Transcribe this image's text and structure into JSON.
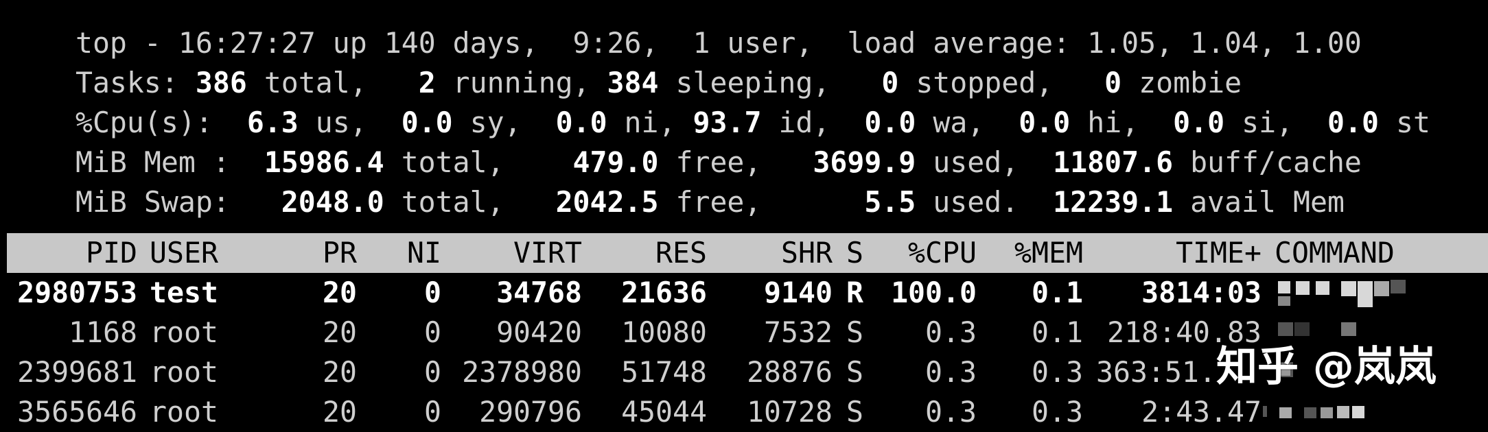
{
  "summary": {
    "line1": {
      "prefix": "top - ",
      "time": "16:27:27",
      "up_label": " up ",
      "uptime": "140 days,  9:26,",
      "users": "  1 user,",
      "load_label": "  load average: ",
      "load": "1.05, 1.04, 1.00"
    },
    "tasks": {
      "label": "Tasks: ",
      "total": "386",
      "total_label": " total,",
      "running": "   2",
      "running_label": " running, ",
      "sleeping": "384",
      "sleeping_label": " sleeping,",
      "stopped": "   0",
      "stopped_label": " stopped,",
      "zombie": "   0",
      "zombie_label": " zombie"
    },
    "cpu": {
      "label": "%Cpu(s): ",
      "us": " 6.3",
      "us_label": " us, ",
      "sy": " 0.0",
      "sy_label": " sy, ",
      "ni": " 0.0",
      "ni_label": " ni, ",
      "id": "93.7",
      "id_label": " id, ",
      "wa": " 0.0",
      "wa_label": " wa, ",
      "hi": " 0.0",
      "hi_label": " hi, ",
      "si": " 0.0",
      "si_label": " si, ",
      "st": " 0.0",
      "st_label": " st"
    },
    "mem": {
      "label": "MiB Mem : ",
      "total": " 15986.4",
      "total_label": " total,",
      "free": "    479.0",
      "free_label": " free,",
      "used": "   3699.9",
      "used_label": " used,",
      "buff": "  11807.6",
      "buff_label": " buff/cache"
    },
    "swap": {
      "label": "MiB Swap: ",
      "total": "  2048.0",
      "total_label": " total,",
      "free": "   2042.5",
      "free_label": " free,",
      "used": "      5.5",
      "used_label": " used.",
      "avail": "  12239.1",
      "avail_label": " avail Mem"
    }
  },
  "columns": [
    "PID",
    "USER",
    "PR",
    "NI",
    "VIRT",
    "RES",
    "SHR",
    "S",
    "%CPU",
    "%MEM",
    "TIME+",
    "COMMAND"
  ],
  "processes": [
    {
      "pid": "2980753",
      "user": "test",
      "pr": "20",
      "ni": "0",
      "virt": "34768",
      "res": "21636",
      "shr": "9140",
      "s": "R",
      "cpu": "100.0",
      "mem": "0.1",
      "time": "3814:03"
    },
    {
      "pid": "1168",
      "user": "root",
      "pr": "20",
      "ni": "0",
      "virt": "90420",
      "res": "10080",
      "shr": "7532",
      "s": "S",
      "cpu": "0.3",
      "mem": "0.1",
      "time": "218:40.83"
    },
    {
      "pid": "2399681",
      "user": "root",
      "pr": "20",
      "ni": "0",
      "virt": "2378980",
      "res": "51748",
      "shr": "28876",
      "s": "S",
      "cpu": "0.3",
      "mem": "0.3",
      "time": "363:51."
    },
    {
      "pid": "3565646",
      "user": "root",
      "pr": "20",
      "ni": "0",
      "virt": "290796",
      "res": "45044",
      "shr": "10728",
      "s": "S",
      "cpu": "0.3",
      "mem": "0.3",
      "time": "2:43.47"
    }
  ],
  "watermark": "知乎 @岚岚",
  "colors": {
    "background": "#000000",
    "text": "#cfcfcf",
    "highlight": "#ffffff",
    "header_bar": "#c8c8c8"
  }
}
